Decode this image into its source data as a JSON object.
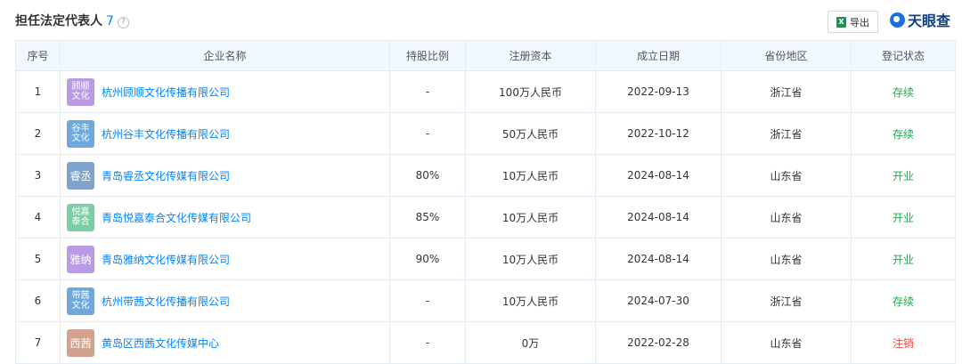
{
  "header": {
    "title": "担任法定代表人",
    "count": "7",
    "help_icon": "?",
    "export_label": "导出",
    "excel_icon": "X",
    "logo_text": "天眼查"
  },
  "columns": [
    "序号",
    "企业名称",
    "持股比例",
    "注册资本",
    "成立日期",
    "省份地区",
    "登记状态"
  ],
  "rows": [
    {
      "no": "1",
      "logo": [
        "顾顺",
        "文化"
      ],
      "logo_color": "#b89be0",
      "name": "杭州顾顺文化传播有限公司",
      "share": "-",
      "capital": "100万人民币",
      "date": "2022-09-13",
      "region": "浙江省",
      "status": "存续",
      "status_color": "green"
    },
    {
      "no": "2",
      "logo": [
        "谷丰",
        "文化"
      ],
      "logo_color": "#6fa8dc",
      "name": "杭州谷丰文化传播有限公司",
      "share": "-",
      "capital": "50万人民币",
      "date": "2022-10-12",
      "region": "浙江省",
      "status": "存续",
      "status_color": "green"
    },
    {
      "no": "3",
      "logo": [
        "睿丞"
      ],
      "logo_color": "#7fa3cc",
      "name": "青岛睿丞文化传媒有限公司",
      "share": "80%",
      "capital": "10万人民币",
      "date": "2024-08-14",
      "region": "山东省",
      "status": "开业",
      "status_color": "green"
    },
    {
      "no": "4",
      "logo": [
        "悦嘉",
        "泰合"
      ],
      "logo_color": "#7ccfa5",
      "name": "青岛悦嘉泰合文化传媒有限公司",
      "share": "85%",
      "capital": "10万人民币",
      "date": "2024-08-14",
      "region": "山东省",
      "status": "开业",
      "status_color": "green"
    },
    {
      "no": "5",
      "logo": [
        "雅纳"
      ],
      "logo_color": "#b99be6",
      "name": "青岛雅纳文化传媒有限公司",
      "share": "90%",
      "capital": "10万人民币",
      "date": "2024-08-14",
      "region": "山东省",
      "status": "开业",
      "status_color": "green"
    },
    {
      "no": "6",
      "logo": [
        "带茜",
        "文化"
      ],
      "logo_color": "#6fa8dc",
      "name": "杭州带茜文化传播有限公司",
      "share": "-",
      "capital": "10万人民币",
      "date": "2024-07-30",
      "region": "浙江省",
      "status": "存续",
      "status_color": "green"
    },
    {
      "no": "7",
      "logo": [
        "西茜"
      ],
      "logo_color": "#d4a18c",
      "name": "黄岛区西茜文化传媒中心",
      "share": "-",
      "capital": "0万",
      "date": "2022-02-28",
      "region": "山东省",
      "status": "注销",
      "status_color": "red"
    }
  ]
}
